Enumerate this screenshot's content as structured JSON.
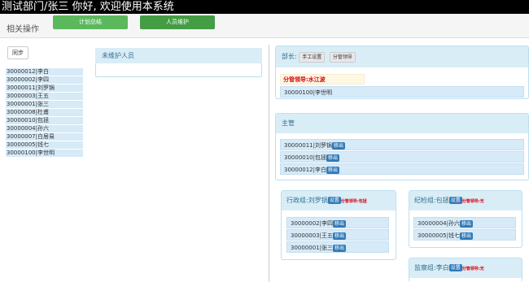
{
  "header": {
    "title": "测试部门/张三  你好, 欢迎使用本系统"
  },
  "ops": {
    "label": "相关操作",
    "plan_btn": "计划总结",
    "staff_btn": "人员维护"
  },
  "left": {
    "sync": "同步",
    "items": [
      "30000012|李白",
      "30000002|李四",
      "30000011|刘罗锅",
      "30000003|王五",
      "30000001|张三",
      "30000008|杜甫",
      "30000010|包拯",
      "30000004|孙六",
      "30000007|白居易",
      "30000005|钱七",
      "30000100|李世明"
    ]
  },
  "unmaintained": {
    "title": "未维护人员"
  },
  "dept": {
    "head_label": "部长",
    "manual_btn": "手工设置",
    "leader_btn": "分管领导",
    "leader_text": "分管领导:水江波",
    "member": "30000100|李世明"
  },
  "supervisor": {
    "title": "主管",
    "move_btn": "移出",
    "rows": [
      "30000011|刘罗锅",
      "30000010|包拯",
      "30000012|李白"
    ]
  },
  "admin_group": {
    "title": "行政组:刘罗锅",
    "set_btn": "设置",
    "leader": "分管领导:包拯",
    "move_btn": "移出",
    "rows": [
      "30000002|李四",
      "30000003|王五",
      "30000001|张三"
    ]
  },
  "discipline_group": {
    "title": "纪检组:包拯",
    "set_btn": "设置",
    "leader": "分管领导:无",
    "move_btn": "移出",
    "rows": [
      "30000004|孙六",
      "30000005|钱七"
    ]
  },
  "supervise_group": {
    "title": "监察组:李白",
    "set_btn": "设置",
    "leader": "分管领导:无"
  },
  "colors": {
    "panel_header": "#d9edf7",
    "row": "#d6eaf8",
    "btn_green": "#5cb85c",
    "btn_blue": "#337ab7",
    "leader_red": "#d9000d"
  }
}
